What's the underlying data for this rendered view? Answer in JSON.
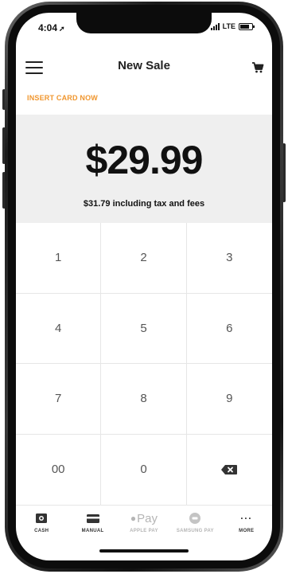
{
  "status_bar": {
    "time": "4:04",
    "network": "LTE"
  },
  "nav": {
    "title": "New Sale"
  },
  "payment": {
    "prompt": "INSERT CARD NOW",
    "amount": "$29.99",
    "total_line": "$31.79 including tax and fees"
  },
  "keypad": {
    "keys": [
      "1",
      "2",
      "3",
      "4",
      "5",
      "6",
      "7",
      "8",
      "9",
      "00",
      "0"
    ]
  },
  "tabs": {
    "cash": "CASH",
    "manual": "MANUAL",
    "apple_pay": "APPLE PAY",
    "apple_pay_logo": "Pay",
    "samsung_pay": "SAMSUNG PAY",
    "more": "MORE"
  },
  "colors": {
    "accent": "#f0962e",
    "panel": "#efefef",
    "disabled": "#b5b5b5"
  }
}
